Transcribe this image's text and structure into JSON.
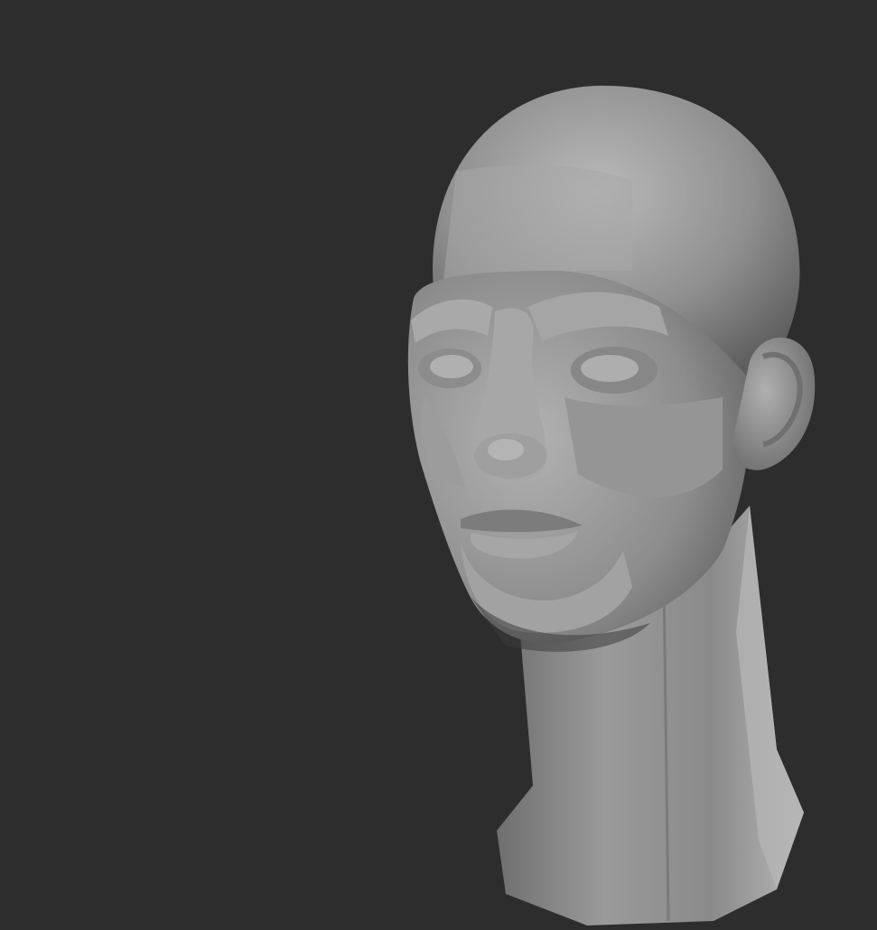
{
  "scene": {
    "background_color": "#2d2d2d",
    "clay_color": "#9a9a9a",
    "subject": "sculpted-head-bust-icon"
  }
}
